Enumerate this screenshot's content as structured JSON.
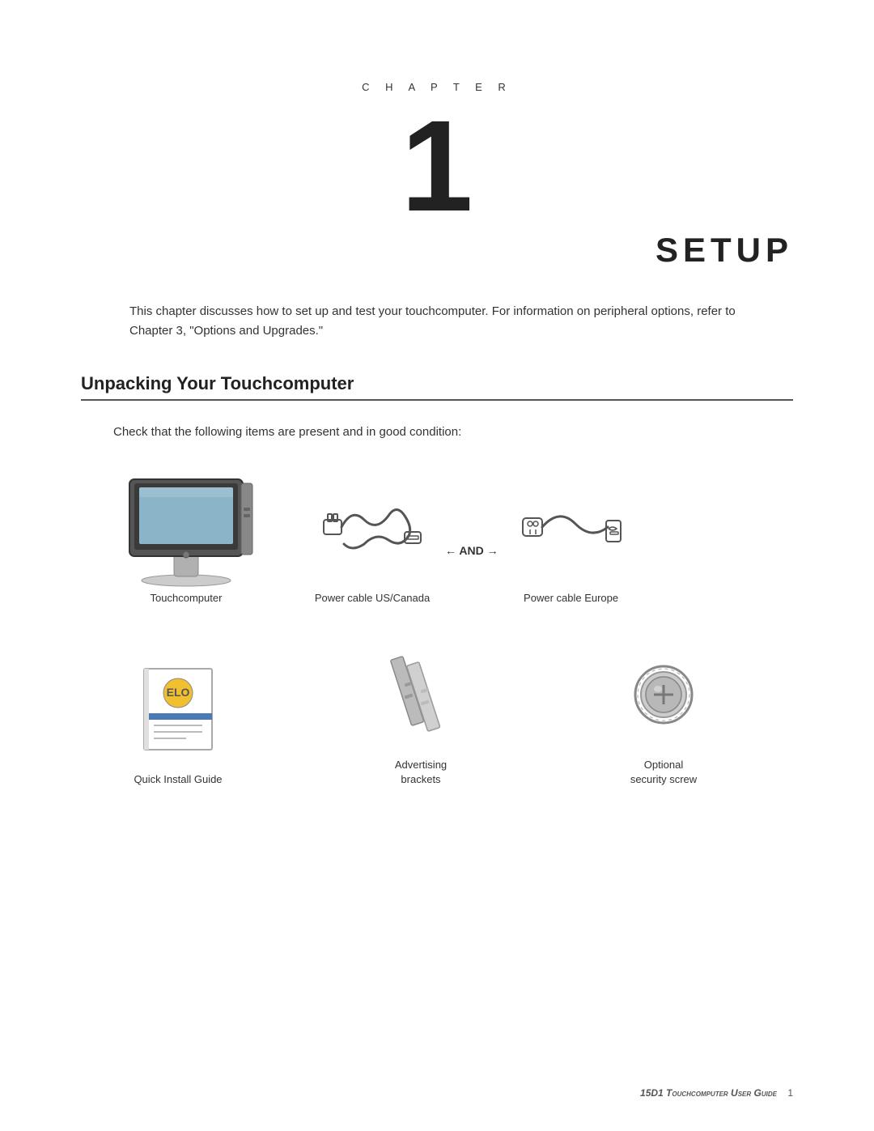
{
  "chapter": {
    "label": "C H A P T E R",
    "number": "1",
    "title": "SETUP"
  },
  "intro": {
    "text": "This chapter discusses how to set up and test your touchcomputer. For information on peripheral options, refer to Chapter 3, \"Options and Upgrades.\""
  },
  "section": {
    "heading": "Unpacking Your Touchcomputer",
    "check_text": "Check that the following items are present and in good condition:"
  },
  "items": {
    "row1": [
      {
        "id": "touchcomputer",
        "label": "Touchcomputer"
      },
      {
        "id": "and_connector",
        "label": "← AND →"
      },
      {
        "id": "power_cable_us",
        "label": "Power cable US/Canada"
      },
      {
        "id": "power_cable_eu",
        "label": "Power cable Europe"
      }
    ],
    "row2": [
      {
        "id": "quick_install",
        "label": "Quick Install Guide"
      },
      {
        "id": "adv_brackets",
        "label": "Advertising\nbrackets"
      },
      {
        "id": "security_screw",
        "label": "Optional\nsecurity screw"
      }
    ]
  },
  "footer": {
    "product": "15D1 Touchcomputer User Guide",
    "page": "1"
  }
}
